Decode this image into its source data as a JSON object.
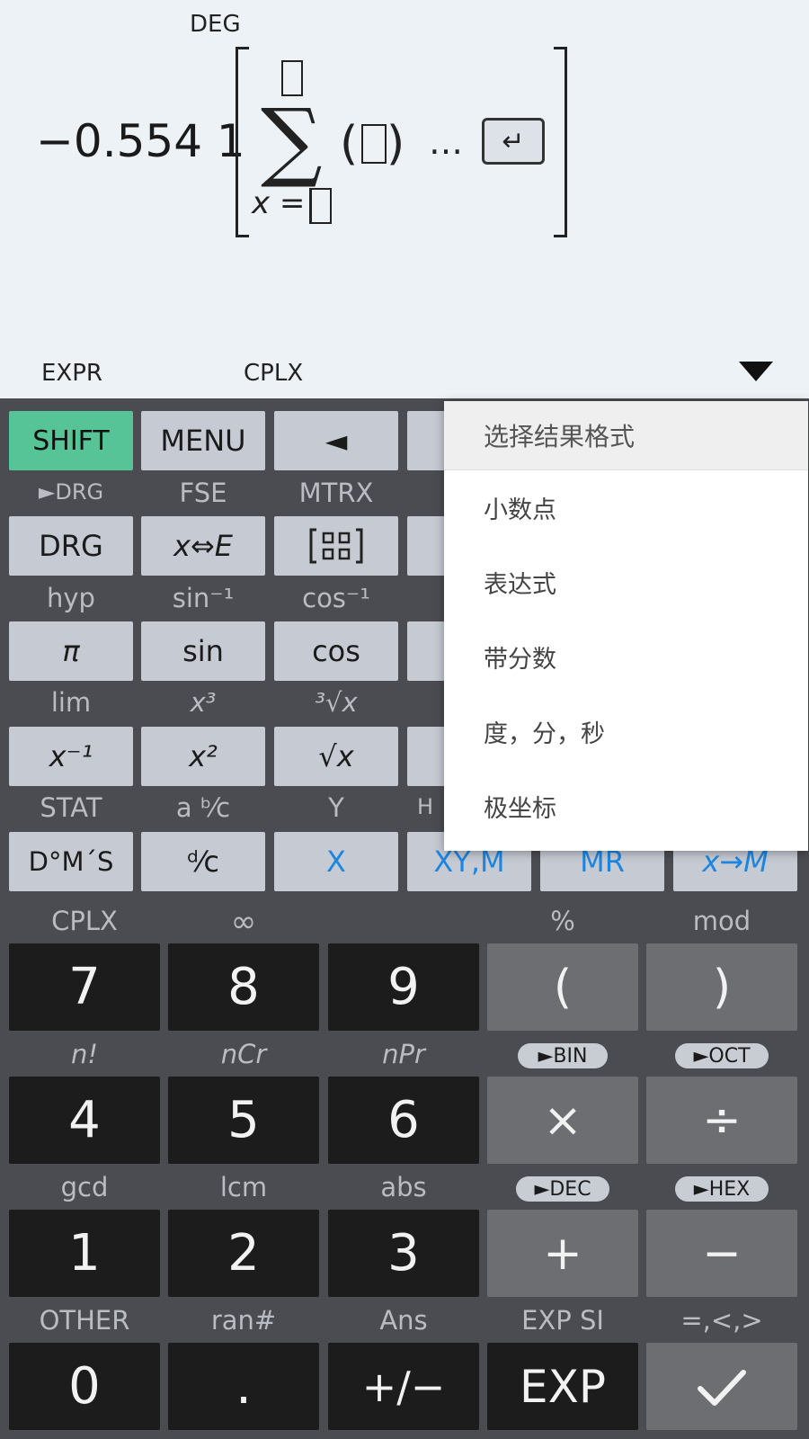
{
  "display": {
    "angle_mode": "DEG",
    "result_value": "−0.554 1",
    "sum_lower_var": "x =",
    "ellipsis": "…",
    "enter_symbol": "↵",
    "mode_left": "EXPR",
    "mode_right": "CPLX",
    "paren_open": "(",
    "paren_close": ")",
    "sigma": "∑"
  },
  "menu": {
    "title": "选择结果格式",
    "items": [
      "小数点",
      "表达式",
      "带分数",
      "度，分，秒",
      "极坐标"
    ]
  },
  "keys": {
    "row1": [
      "SHIFT",
      "MENU",
      "◄"
    ],
    "row1_labels": [
      "►DRG",
      "FSE",
      "MTRX"
    ],
    "row2": [
      "DRG",
      "x⇔E",
      "[ ]"
    ],
    "row2_labels": [
      "hyp",
      "sin⁻¹",
      "cos⁻¹"
    ],
    "row3": [
      "π",
      "sin",
      "cos"
    ],
    "row3_labels": [
      "lim",
      "x³",
      "³√x"
    ],
    "row4": [
      "x⁻¹",
      "x²",
      "√x"
    ],
    "row4_labels": [
      "STAT",
      "a ᵇ⁄c",
      "Y",
      "H"
    ],
    "row5": [
      "D°M´S",
      "ᵈ⁄c",
      "X",
      "XY,M",
      "MR",
      "x→M"
    ],
    "num_labels_1": [
      "CPLX",
      "∞",
      "",
      "%",
      "mod"
    ],
    "num_row_1": [
      "7",
      "8",
      "9",
      "(",
      ")"
    ],
    "num_labels_2": [
      "n!",
      "nCr",
      "nPr",
      "►BIN",
      "►OCT"
    ],
    "num_row_2": [
      "4",
      "5",
      "6",
      "×",
      "÷"
    ],
    "num_labels_3": [
      "gcd",
      "lcm",
      "abs",
      "►DEC",
      "►HEX"
    ],
    "num_row_3": [
      "1",
      "2",
      "3",
      "+",
      "−"
    ],
    "num_labels_4": [
      "OTHER",
      "ran#",
      "Ans",
      "EXP SI",
      "=,<,>"
    ],
    "num_row_4": [
      "0",
      ".",
      "+/−",
      "EXP",
      "✓"
    ]
  }
}
